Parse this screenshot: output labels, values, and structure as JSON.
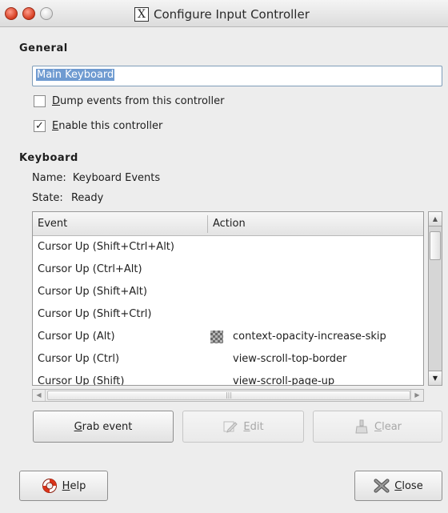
{
  "window": {
    "title": "Configure Input Controller",
    "x_glyph": "X"
  },
  "general": {
    "heading": "General",
    "name_value": "Main Keyboard",
    "dump_events": {
      "label_underlined": "D",
      "label_rest": "ump events from this controller",
      "checked": false
    },
    "enable": {
      "label_underlined": "E",
      "label_rest": "nable this controller",
      "checked": true,
      "mark": "✓"
    }
  },
  "keyboard": {
    "heading": "Keyboard",
    "name_label": "Name:",
    "name_value": "Keyboard Events",
    "state_label": "State:",
    "state_value": "Ready"
  },
  "table": {
    "columns": [
      "Event",
      "Action"
    ],
    "rows": [
      {
        "event": "Cursor Up (Shift+Ctrl+Alt)",
        "action": ""
      },
      {
        "event": "Cursor Up (Ctrl+Alt)",
        "action": ""
      },
      {
        "event": "Cursor Up (Shift+Alt)",
        "action": ""
      },
      {
        "event": "Cursor Up (Shift+Ctrl)",
        "action": ""
      },
      {
        "event": "Cursor Up (Alt)",
        "action": "context-opacity-increase-skip",
        "icon": "checkerboard-icon"
      },
      {
        "event": "Cursor Up (Ctrl)",
        "action": "view-scroll-top-border"
      },
      {
        "event": "Cursor Up (Shift)",
        "action": "view-scroll-page-up"
      }
    ]
  },
  "buttons": {
    "grab": {
      "u": "G",
      "rest": "rab event"
    },
    "edit": {
      "u": "E",
      "rest": "dit"
    },
    "clear": {
      "u": "C",
      "rest": "lear"
    },
    "help": {
      "u": "H",
      "rest": "elp"
    },
    "close": {
      "u": "C",
      "rest": "lose"
    }
  },
  "colors": {
    "selection": "#6f9bd1",
    "close_red": "#d43b1f",
    "help_red": "#d9341a"
  }
}
